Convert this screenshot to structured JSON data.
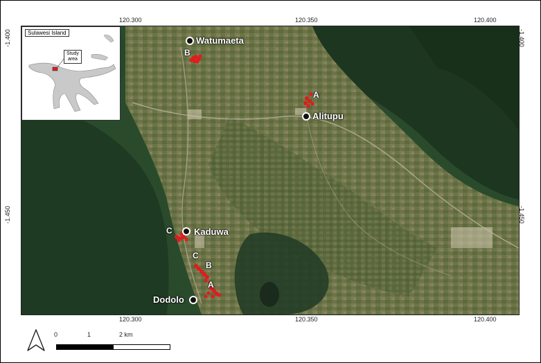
{
  "axes": {
    "x_top": [
      "120.300",
      "120.350",
      "120.400"
    ],
    "x_bottom": [
      "120.300",
      "120.350",
      "120.400"
    ],
    "y_left": [
      "-1.400",
      "-1.450"
    ],
    "y_right": [
      "-1.400",
      "-1.450"
    ]
  },
  "localities": {
    "watumaeta": "Watumaeta",
    "alitupu": "Alitupu",
    "kaduwa": "Kaduwa",
    "dodolo": "Dodolo"
  },
  "sites": {
    "watumaeta_b": "B",
    "alitupu_a": "A",
    "kaduwa_c": "C",
    "dodolo_c": "C",
    "dodolo_b": "B",
    "dodolo_a": "A"
  },
  "inset": {
    "title": "Sulawesi Island",
    "callout_line1": "Study",
    "callout_line2": "area"
  },
  "scale_bar": {
    "labels": [
      "0",
      "1",
      "2 km"
    ]
  },
  "colors": {
    "sample_points": "#e31a1c",
    "forest_dark": "#1f3a22",
    "valley": "#5f6f45"
  },
  "icons": {
    "north_arrow": "north-arrow-icon"
  }
}
